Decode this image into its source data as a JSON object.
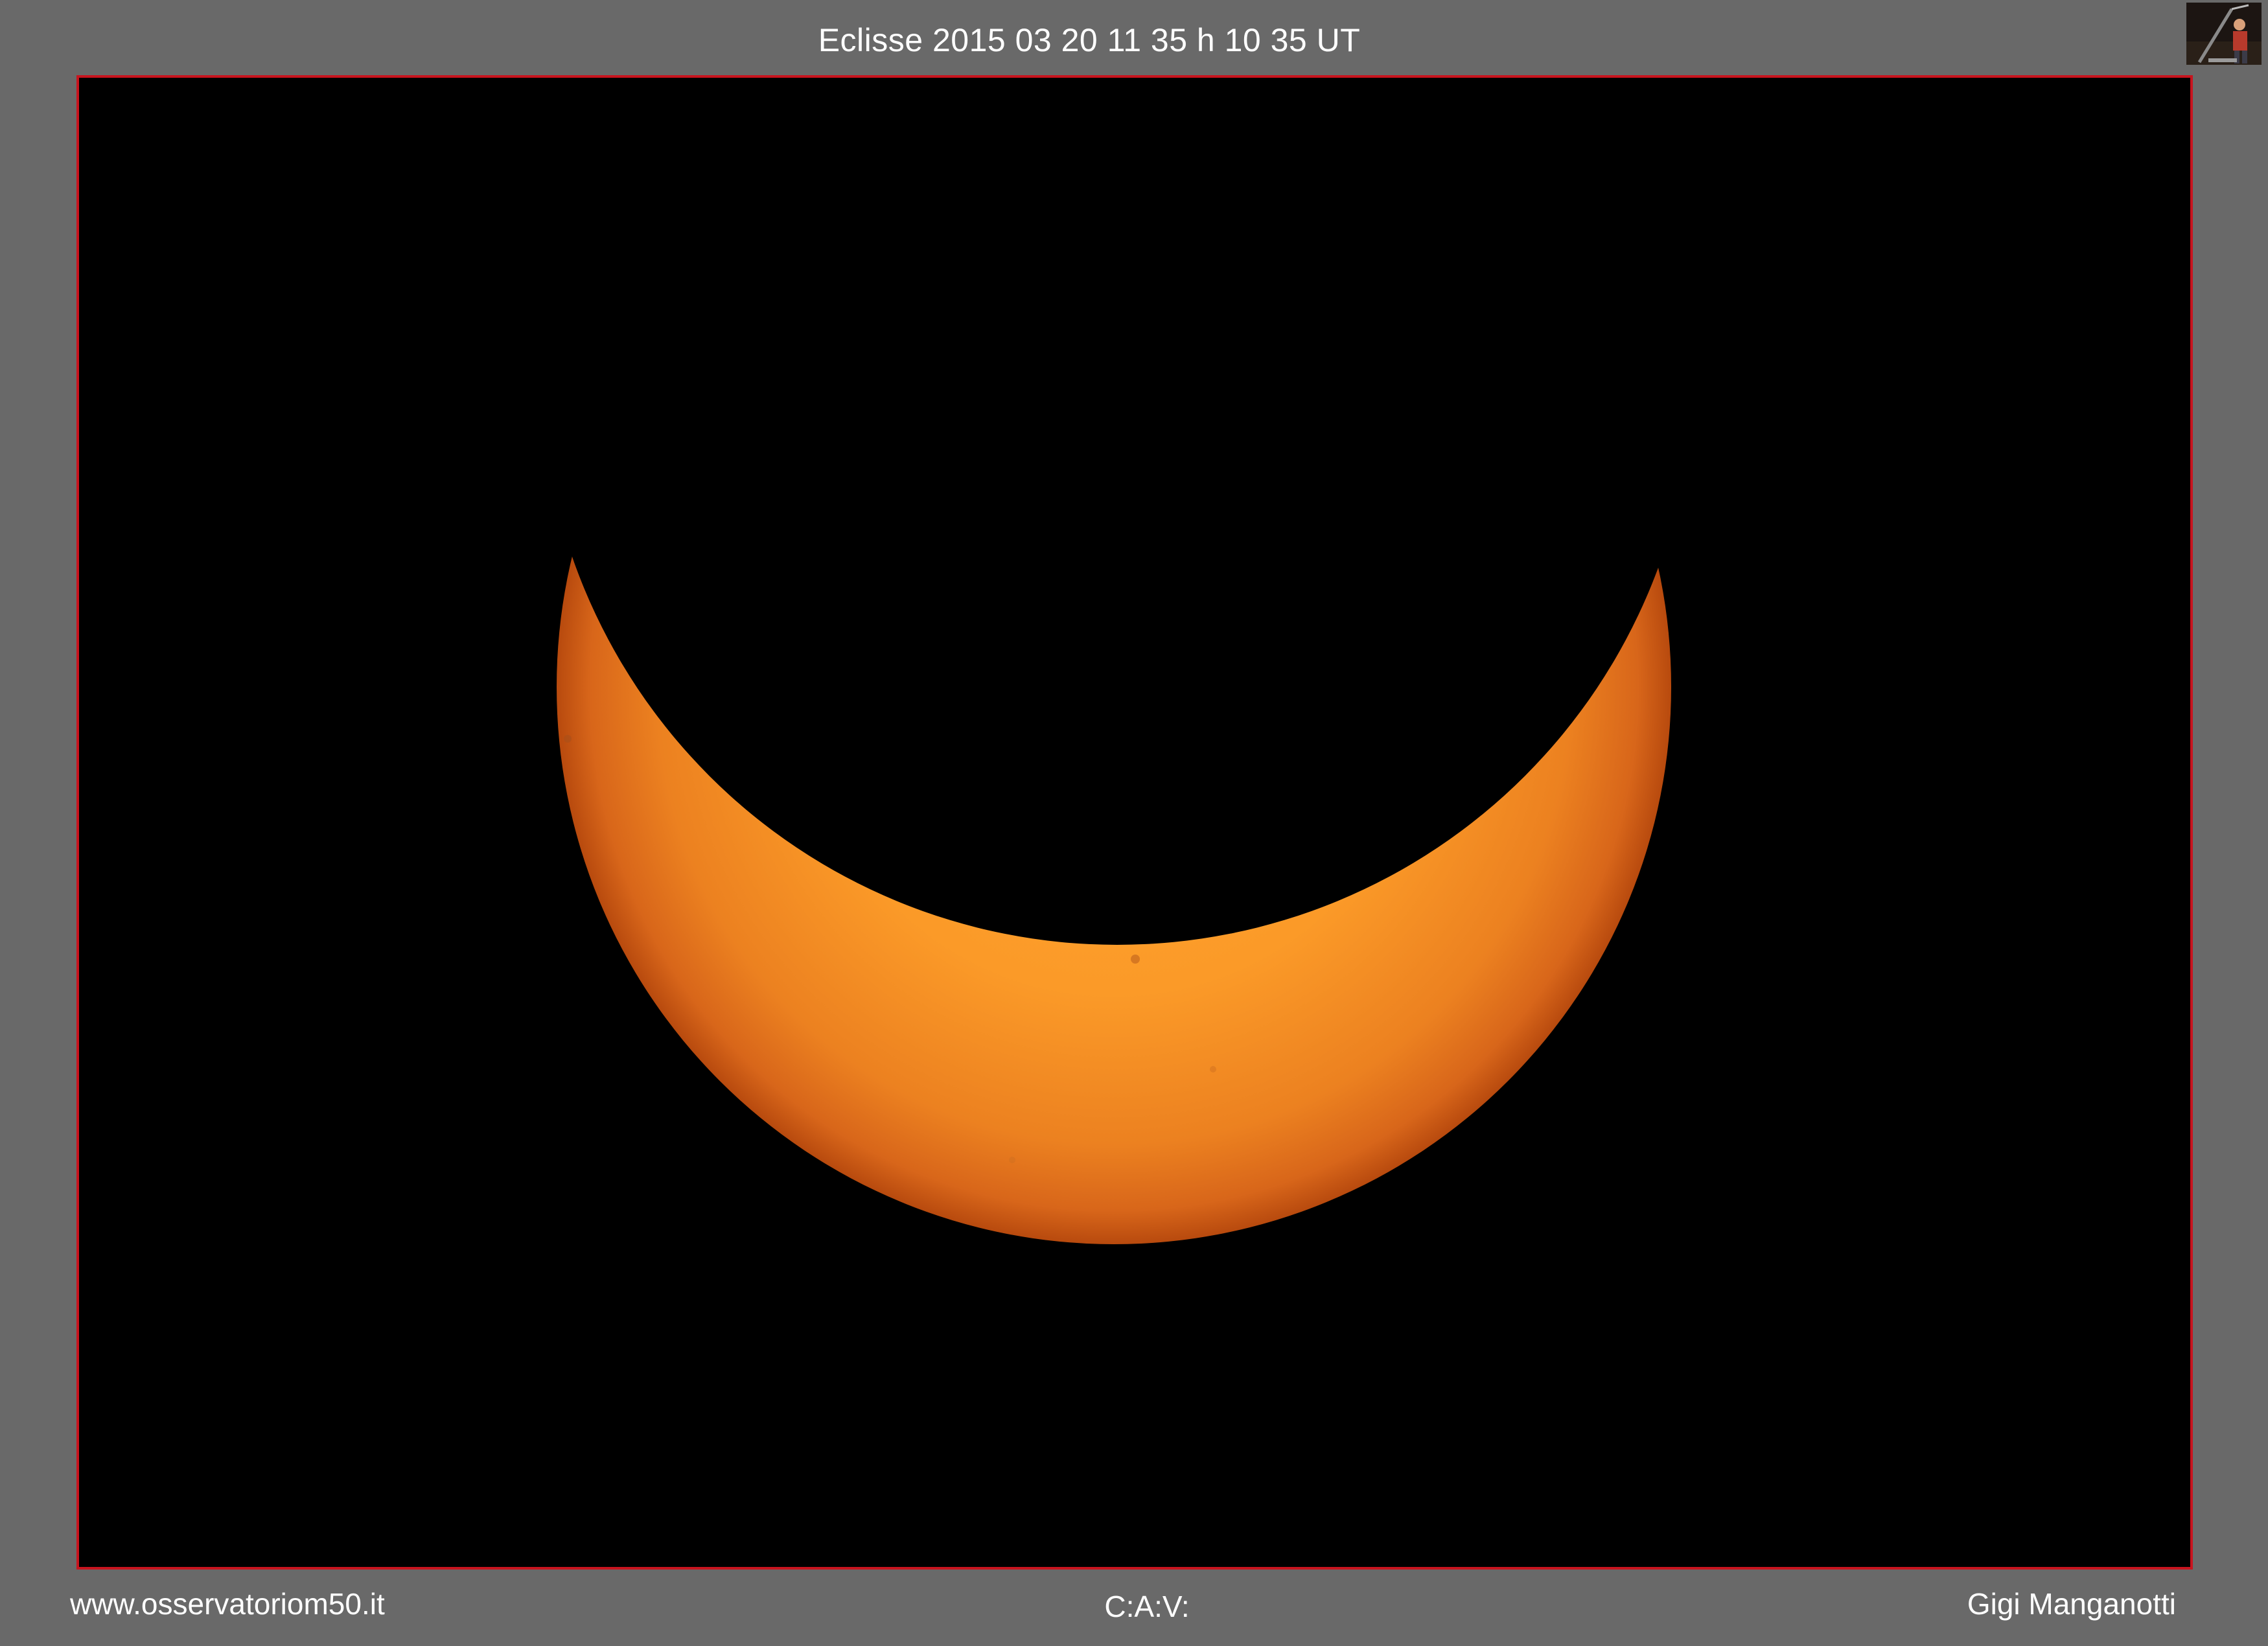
{
  "header": {
    "title": "Eclisse 2015 03 20 11 35 h 10 35 UT"
  },
  "thumbnail": {
    "icon": "observer-photo-icon"
  },
  "image": {
    "subject": "partial-solar-eclipse",
    "colors": {
      "background": "#000000",
      "sun_center": "#ffa531",
      "sun_limb": "#c8520c",
      "frame_border": "#c8141e",
      "page_background": "#696969"
    }
  },
  "footer": {
    "website": "www.osservatoriom50.it",
    "center_label": "C:A:V:",
    "author": "Gigi Manganotti"
  }
}
